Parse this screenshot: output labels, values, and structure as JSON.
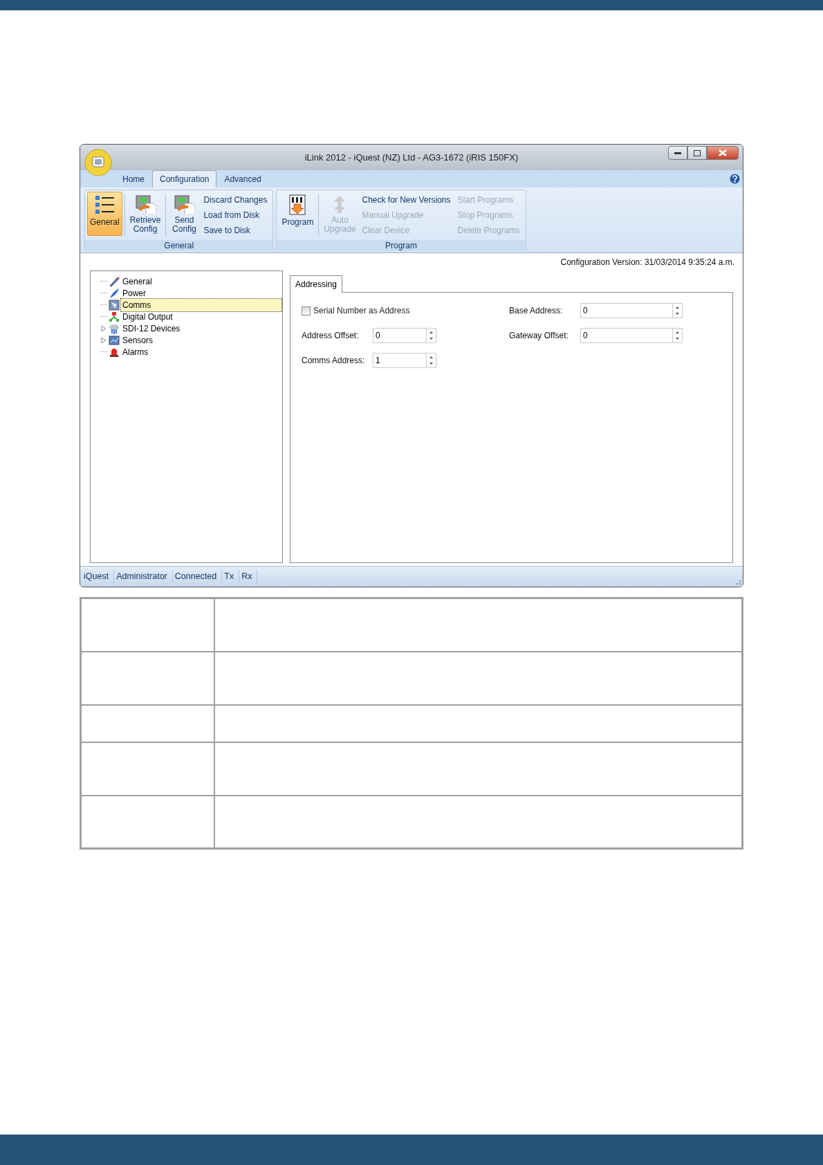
{
  "window": {
    "title": "iLink 2012 - iQuest (NZ) Ltd - AG3-1672 (iRIS 150FX)"
  },
  "tabs": [
    {
      "label": "Home",
      "selected": false
    },
    {
      "label": "Configuration",
      "selected": true
    },
    {
      "label": "Advanced",
      "selected": false
    }
  ],
  "ribbon": [
    {
      "label": "General",
      "items": [
        {
          "kind": "large",
          "label": "General",
          "selected": true,
          "disabled": false
        },
        {
          "kind": "large",
          "label": "Retrieve\nConfig",
          "selected": false,
          "disabled": false
        },
        {
          "kind": "large",
          "label": "Send\nConfig",
          "selected": false,
          "disabled": false
        },
        {
          "kind": "small",
          "label": "Discard Changes",
          "disabled": false
        },
        {
          "kind": "small",
          "label": "Load from Disk",
          "disabled": false
        },
        {
          "kind": "small",
          "label": "Save to Disk",
          "disabled": false
        }
      ]
    },
    {
      "label": "Program",
      "items": [
        {
          "kind": "large",
          "label": "Program",
          "selected": false,
          "disabled": false
        },
        {
          "kind": "large",
          "label": "Auto\nUpgrade",
          "selected": false,
          "disabled": true
        },
        {
          "kind": "small",
          "label": "Check for New Versions",
          "disabled": false
        },
        {
          "kind": "small",
          "label": "Manual Upgrade",
          "disabled": true
        },
        {
          "kind": "small",
          "label": "Clear Device",
          "disabled": true
        },
        {
          "kind": "small",
          "label": "Start Programs",
          "disabled": true
        },
        {
          "kind": "small",
          "label": "Stop Programs",
          "disabled": true
        },
        {
          "kind": "small",
          "label": "Delete Programs",
          "disabled": true
        }
      ]
    }
  ],
  "config_version": "Configuration Version: 31/03/2014 9:35:24 a.m.",
  "tree": [
    {
      "label": "General",
      "selected": false
    },
    {
      "label": "Power",
      "selected": false
    },
    {
      "label": "Comms",
      "selected": true
    },
    {
      "label": "Digital Output",
      "selected": false
    },
    {
      "label": "SDI-12 Devices",
      "selected": false,
      "expandable": true
    },
    {
      "label": "Sensors",
      "selected": false,
      "expandable": true
    },
    {
      "label": "Alarms",
      "selected": false
    }
  ],
  "panel_tabs": [
    {
      "label": "Addressing",
      "selected": true
    }
  ],
  "form": {
    "checkbox": {
      "label": "Serial Number as Address",
      "checked": false
    },
    "left_fields": [
      {
        "label": "Address Offset:",
        "value": "0"
      },
      {
        "label": "Comms Address:",
        "value": "1"
      }
    ],
    "right_fields": [
      {
        "label": "Base Address:",
        "value": "0"
      },
      {
        "label": "Gateway Offset:",
        "value": "0"
      }
    ]
  },
  "status_bar": [
    "iQuest",
    "Administrator",
    "Connected",
    "Tx",
    "Rx"
  ],
  "table": {
    "rows": [
      {
        "kind": "tall"
      },
      {
        "kind": "tall"
      },
      {
        "kind": "short"
      },
      {
        "kind": "tall"
      },
      {
        "kind": "tall"
      }
    ]
  }
}
